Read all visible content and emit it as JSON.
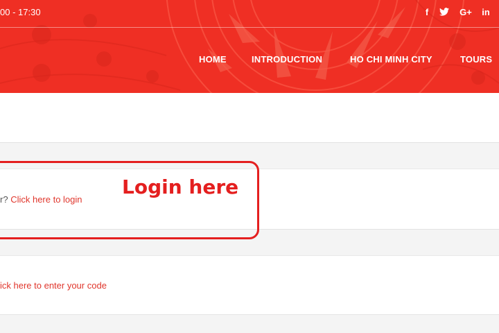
{
  "header": {
    "hours": "00 - 17:30",
    "social": [
      "f",
      "t",
      "G+",
      "in"
    ],
    "nav": [
      "HOME",
      "INTRODUCTION",
      "HO CHI MINH CITY",
      "TOURS"
    ],
    "colors": {
      "header_bg": "#ef2f24",
      "link": "#e0362c",
      "annotation": "#e41f1f"
    }
  },
  "login_notice": {
    "prefix": "r?",
    "link": "Click here to login"
  },
  "coupon_notice": {
    "link": "ick here to enter your code"
  },
  "annotation": {
    "label": "Login here"
  }
}
